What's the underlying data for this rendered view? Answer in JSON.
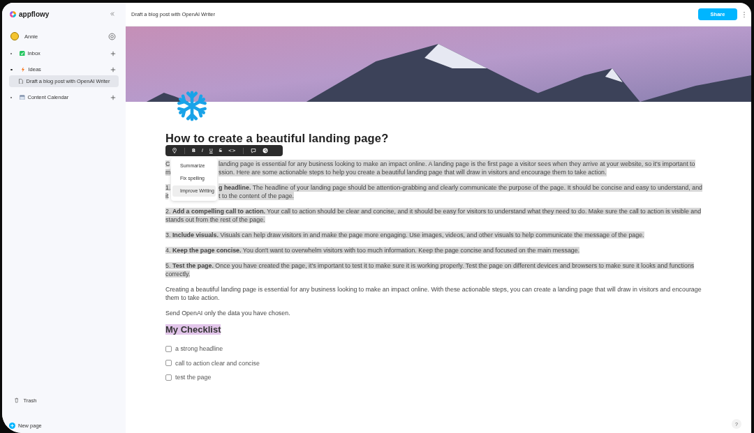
{
  "app": {
    "name": "appflowy"
  },
  "user": {
    "name": "Annie"
  },
  "sidebar": {
    "items": [
      {
        "label": "Inbox",
        "expanded": false,
        "selected": false
      },
      {
        "label": "Ideas",
        "expanded": true,
        "selected": false,
        "children": [
          {
            "label": "Draft a blog post with OpenAI Writer",
            "selected": true
          }
        ]
      },
      {
        "label": "Content Calendar",
        "expanded": false,
        "selected": false
      }
    ],
    "trash": "Trash",
    "new_page": "New page"
  },
  "header": {
    "title": "Draft a blog post with OpenAI Writer",
    "share": "Share"
  },
  "document": {
    "title": "How to create a beautiful landing page?",
    "blocks": [
      {
        "kind": "covered",
        "selected": true,
        "lines": [
          {
            "start": "C",
            "rest": "landing page is essential for any business looking to make an impact online. A landing page is the first page a visitor sees when they arrive at your website, so it's important to"
          },
          {
            "start": "m",
            "rest": "ssion. Here are some actionable steps to help you create a beautiful landing page that will draw in visitors and encourage them to take action."
          }
        ]
      },
      {
        "kind": "covered",
        "selected": true,
        "lines": [
          {
            "start": "1.",
            "rest": "**g headline.** The headline of your landing page should be attention-grabbing and clearly communicate the purpose of the page. It should be concise and easy to understand, and"
          },
          {
            "start": "it",
            "rest": "t to the content of the page."
          }
        ]
      },
      {
        "kind": "paragraph",
        "selected": true,
        "text": "2. **Add a compelling call to action.** Your call to action should be clear and concise, and it should be easy for visitors to understand what they need to do. Make sure the call to action is visible and stands out from the rest of the page."
      },
      {
        "kind": "paragraph",
        "selected": true,
        "text": "3. **Include visuals.** Visuals can help draw visitors in and make the page more engaging. Use images, videos, and other visuals to help communicate the message of the page."
      },
      {
        "kind": "paragraph",
        "selected": true,
        "text": "4. **Keep the page concise.** You don't want to overwhelm visitors with too much information. Keep the page concise and focused on the main message."
      },
      {
        "kind": "paragraph",
        "selected": true,
        "text": "5. **Test the page.** Once you have created the page, it's important to test it to make sure it is working properly. Test the page on different devices and browsers to make sure it looks and functions correctly."
      },
      {
        "kind": "paragraph",
        "selected": false,
        "text": "Creating a beautiful landing page is essential for any business looking to make an impact online. With these actionable steps, you can create a landing page that will draw in visitors and encourage them to take action."
      },
      {
        "kind": "paragraph",
        "selected": false,
        "text": "Send OpenAI only the data you have chosen."
      },
      {
        "kind": "heading",
        "selected": true,
        "text": "My Checklist"
      },
      {
        "kind": "todo",
        "checked": false,
        "text": "a strong headline"
      },
      {
        "kind": "todo",
        "checked": false,
        "text": "call to action clear and concise"
      },
      {
        "kind": "todo",
        "checked": false,
        "text": "test the page"
      }
    ]
  },
  "toolbar": {
    "format_buttons": [
      "B",
      "I",
      "U",
      "S",
      "<>"
    ]
  },
  "ai_menu": {
    "items": [
      {
        "label": "Summarize",
        "selected": false
      },
      {
        "label": "Fix spelling",
        "selected": false
      },
      {
        "label": "Improve Writing",
        "selected": true
      }
    ]
  },
  "help": "?"
}
